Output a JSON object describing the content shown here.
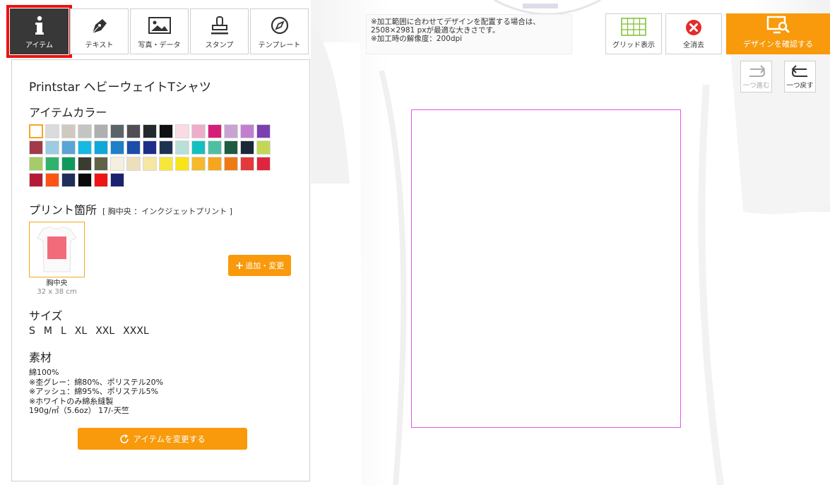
{
  "tool_tabs": [
    {
      "label": "アイテム",
      "icon": "info-icon",
      "active": true
    },
    {
      "label": "テキスト",
      "icon": "pen-icon",
      "active": false
    },
    {
      "label": "写真・データ",
      "icon": "image-icon",
      "active": false
    },
    {
      "label": "スタンプ",
      "icon": "stamp-icon",
      "active": false
    },
    {
      "label": "テンプレート",
      "icon": "compass-icon",
      "active": false
    }
  ],
  "notice": {
    "lines": [
      "※加工範囲に合わせてデザインを配置する場合は、",
      "2508×2981 pxが最適な大きさです。",
      "※加工時の解像度：200dpi"
    ]
  },
  "toolbar": {
    "grid_label": "グリッド表示",
    "clear_label": "全消去",
    "confirm_label": "デザインを確認する",
    "redo_label": "一つ進む",
    "undo_label": "一つ戻す"
  },
  "panel": {
    "item_name": "Printstar ヘビーウェイトTシャツ",
    "color_title": "アイテムカラー",
    "colors": [
      [
        "#ffffff",
        "#d9dbdd",
        "#cfc9c0",
        "#c4c4c0",
        "#aeb0b0",
        "#5b6469",
        "#4f4f55",
        "#24292c",
        "#111111",
        "#f9dce3",
        "#eeadc9",
        "#d61e78",
        "#c7a4d2",
        "#c27fd0",
        "#7b3fb0"
      ],
      [
        "#a23a4a",
        "#9dcbe3",
        "#5aa4d6",
        "#15b9e3",
        "#0fa8d8",
        "#1f7fc7",
        "#1a4ea8",
        "#1d2e88",
        "#1e3352",
        "#b6e0d8",
        "#13c0c0",
        "#4fbfa3",
        "#1f5a42",
        "#1a2738",
        "#c3d755"
      ],
      [
        "#a6cb6a",
        "#2fb36c",
        "#0e9a5c",
        "#3a3c30",
        "#5f6348",
        "#f5efdf",
        "#ece0bc",
        "#f6e7a2",
        "#f6e83b",
        "#f7e517",
        "#f5b92b",
        "#f5a61c",
        "#ef7a14",
        "#e5383b",
        "#e0243d"
      ],
      [
        "#b31a35",
        "#ff5314",
        "#1d2f5a",
        "#0a0a0a",
        "#f01515",
        "#1a2270"
      ]
    ],
    "selected_color": "#ffffff",
    "print_title": "プリント箇所",
    "print_sub": "[ 胸中央 ：インクジェットプリント ]",
    "print_location": "胸中央",
    "print_size": "32 x 38 cm",
    "add_button": "追加・変更",
    "size_title": "サイズ",
    "sizes": [
      "S",
      "M",
      "L",
      "XL",
      "XXL",
      "XXXL"
    ],
    "material_title": "素材",
    "material_lines": [
      "綿100%",
      "※杢グレー：綿80%、ポリステル20%",
      "※アッシュ：綿95%、ポリステル5%",
      "※ホワイトのみ綿糸縫製",
      "190g/㎡（5.6oz） 17/-天竺"
    ],
    "change_button": "アイテムを変更する"
  },
  "colors": {
    "accent": "#f89a0b",
    "active_tab": "#383838",
    "highlight": "#ee1111",
    "print_area_border": "#e455e6"
  }
}
